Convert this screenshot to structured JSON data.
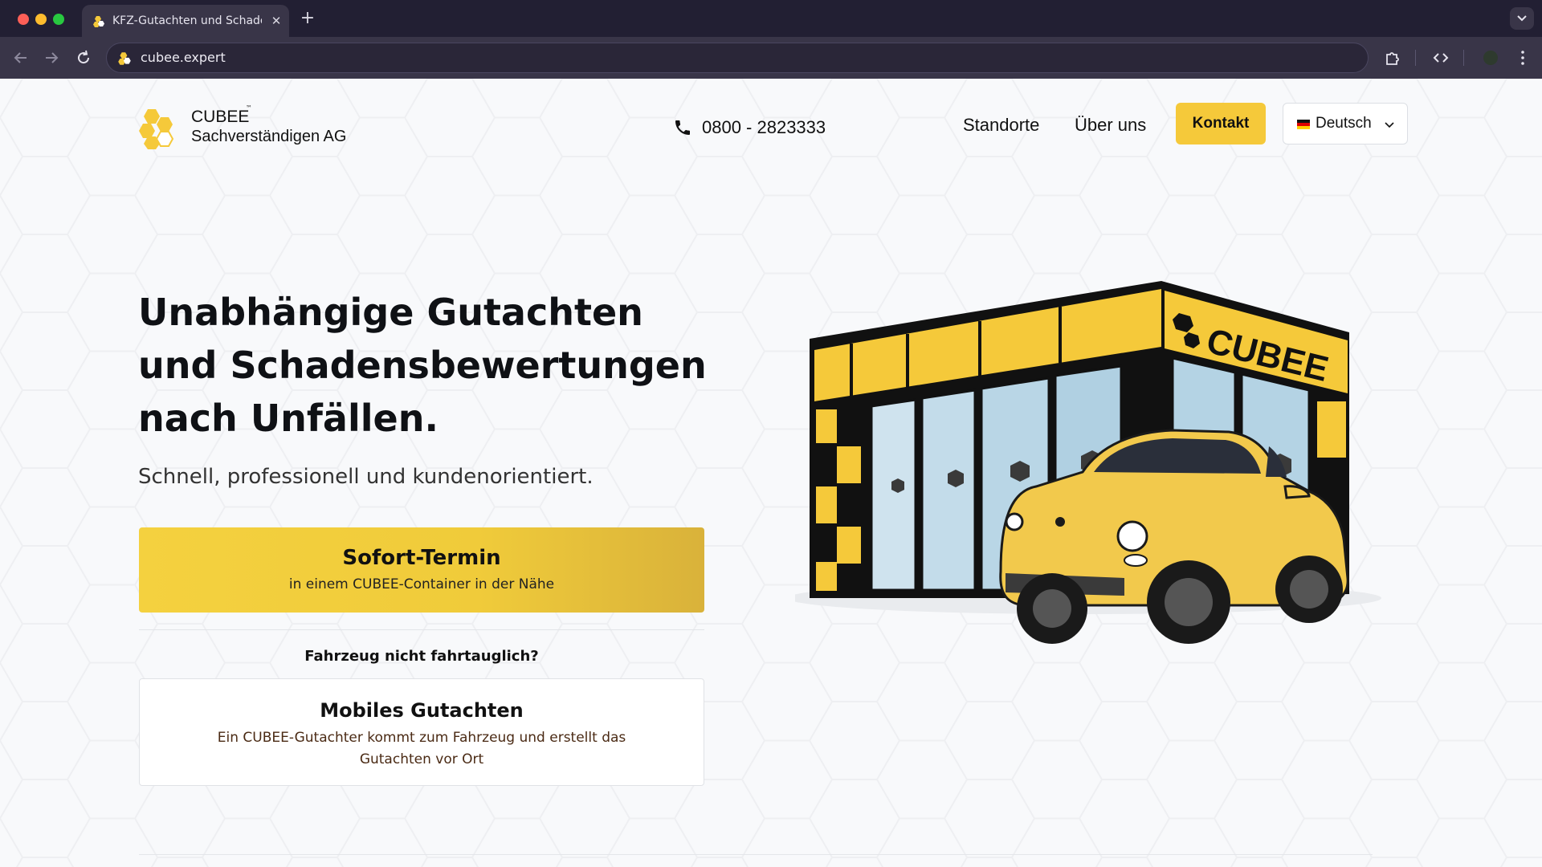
{
  "browser": {
    "tab_title": "KFZ-Gutachten und Schadensbewertung",
    "tab_close": "✕",
    "new_tab": "+",
    "url": "cubee.expert"
  },
  "header": {
    "logo_line1": "CUBEE",
    "logo_tm": "™",
    "logo_line2": "Sachverständigen AG",
    "phone": "0800 - 2823333",
    "nav": {
      "standorte": "Standorte",
      "ueber_uns": "Über uns",
      "kontakt": "Kontakt"
    },
    "language": "Deutsch"
  },
  "hero": {
    "headline_line1": "Unabhängige Gutachten",
    "headline_line2": "und Schadensbewertungen",
    "headline_line3": "nach Unfällen.",
    "subline": "Schnell, professionell und kundenorientiert.",
    "cta_title": "Sofort-Termin",
    "cta_subtitle": "in einem CUBEE-Container in der Nähe",
    "question": "Fahrzeug nicht fahrtauglich?",
    "mobile_title": "Mobiles Gutachten",
    "mobile_desc": "Ein CUBEE-Gutachter kommt zum Fahrzeug und erstellt das Gutachten vor Ort"
  },
  "illustration": {
    "sign_text": "CUBEE",
    "sign_tm": "™"
  },
  "colors": {
    "brand_yellow": "#f5c93a",
    "chrome_dark": "#221f33",
    "chrome_toolbar": "#393548"
  },
  "icons": {
    "back": "arrow-left-icon",
    "forward": "arrow-right-icon",
    "reload": "reload-icon",
    "extensions": "puzzle-icon",
    "devtools": "code-icon",
    "profile": "profile-icon",
    "menu": "kebab-menu-icon",
    "phone": "phone-icon",
    "chevron": "chevron-down-icon"
  }
}
